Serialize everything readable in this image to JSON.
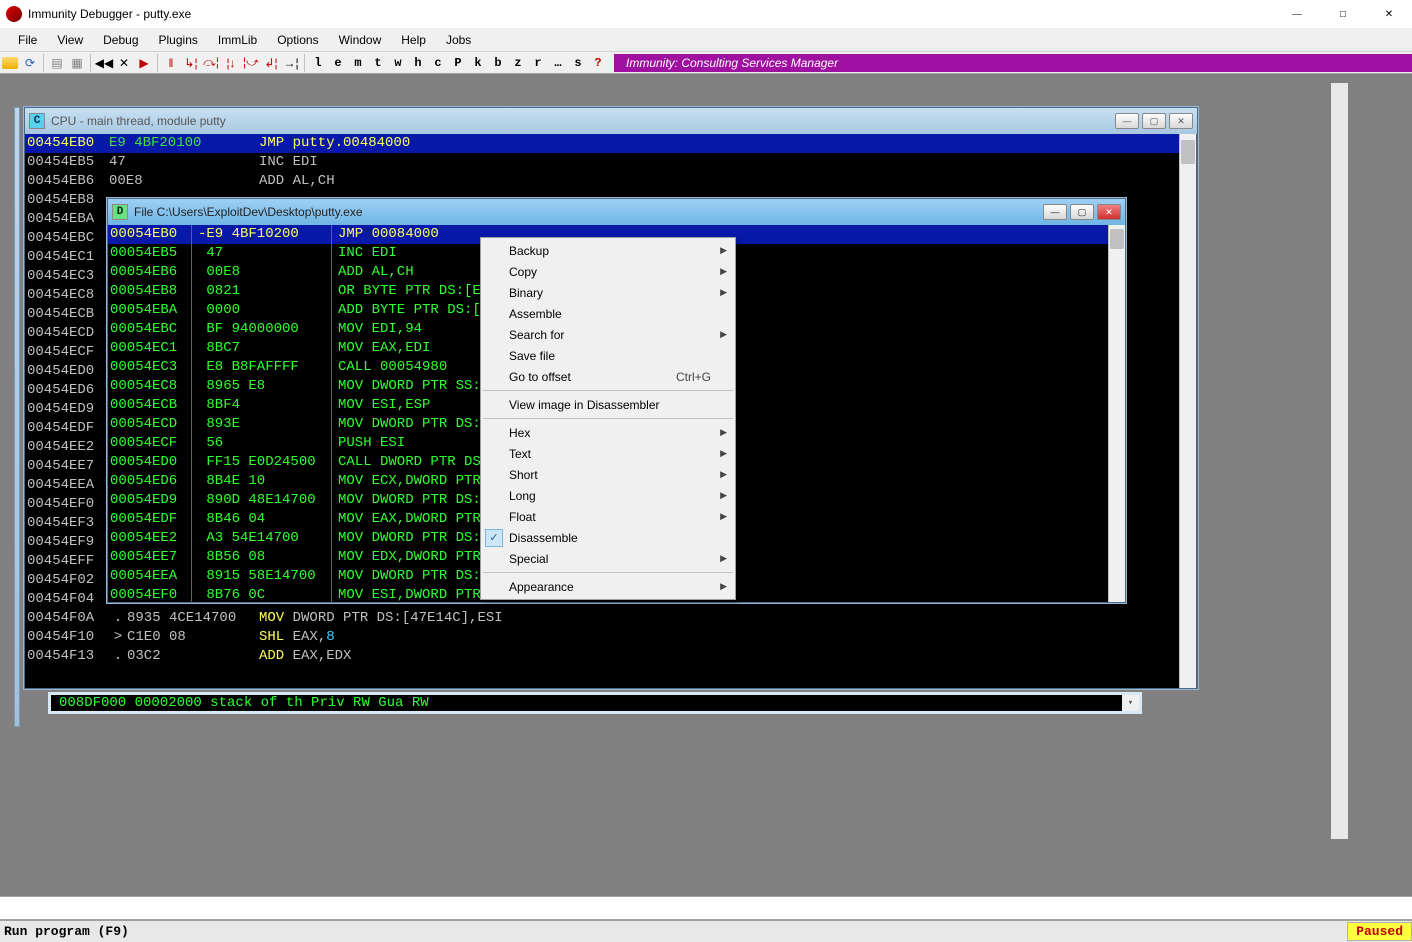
{
  "app": {
    "title": "Immunity Debugger - putty.exe"
  },
  "menu": [
    "File",
    "View",
    "Debug",
    "Plugins",
    "ImmLib",
    "Options",
    "Window",
    "Help",
    "Jobs"
  ],
  "toolbar": {
    "letters": [
      "l",
      "e",
      "m",
      "t",
      "w",
      "h",
      "c",
      "P",
      "k",
      "b",
      "z",
      "r",
      "…",
      "s",
      "?"
    ],
    "banner": "Immunity: Consulting Services Manager"
  },
  "cpu_window": {
    "title": "CPU - main thread, module putty",
    "rows": [
      {
        "addr": "00454EB0",
        "hex": "E9 4BF20100",
        "asm": "JMP putty.00484000",
        "sel": true
      },
      {
        "addr": "00454EB5",
        "hex": "47",
        "asm": "INC EDI"
      },
      {
        "addr": "00454EB6",
        "hex": "00E8",
        "asm": "ADD AL,CH"
      },
      {
        "addr": "00454EB8",
        "hex": "",
        "asm": ""
      },
      {
        "addr": "00454EBA",
        "hex": "",
        "asm": ""
      },
      {
        "addr": "00454EBC",
        "hex": "",
        "asm": ""
      },
      {
        "addr": "00454EC1",
        "hex": "",
        "asm": ""
      },
      {
        "addr": "00454EC3",
        "hex": "",
        "asm": ""
      },
      {
        "addr": "00454EC8",
        "hex": "",
        "asm": ""
      },
      {
        "addr": "00454ECB",
        "hex": "",
        "asm": ""
      },
      {
        "addr": "00454ECD",
        "hex": "",
        "asm": ""
      },
      {
        "addr": "00454ECF",
        "hex": "",
        "asm": ""
      },
      {
        "addr": "00454ED0",
        "hex": "",
        "asm": ""
      },
      {
        "addr": "00454ED6",
        "hex": "",
        "asm": ""
      },
      {
        "addr": "00454ED9",
        "hex": "",
        "asm": ""
      },
      {
        "addr": "00454EDF",
        "hex": "",
        "asm": ""
      },
      {
        "addr": "00454EE2",
        "hex": "",
        "asm": ""
      },
      {
        "addr": "00454EE7",
        "hex": "",
        "asm": ""
      },
      {
        "addr": "00454EEA",
        "hex": "",
        "asm": ""
      },
      {
        "addr": "00454EF0",
        "hex": "",
        "asm": ""
      },
      {
        "addr": "00454EF3",
        "hex": "",
        "asm": ""
      },
      {
        "addr": "00454EF9",
        "hex": "",
        "asm": ""
      },
      {
        "addr": "00454EFF",
        "hex": "",
        "asm": ""
      },
      {
        "addr": "00454F02",
        "hex": "",
        "asm": ""
      },
      {
        "addr": "00454F04",
        "hex": "",
        "asm": ""
      }
    ],
    "tail_rows": [
      {
        "marker": ".",
        "addr": "00454F0A",
        "hex": "8935 4CE14700",
        "mnem": "MOV",
        "ops": "DWORD PTR DS:[47E14C],ESI"
      },
      {
        "marker": ">",
        "addr": "00454F10",
        "hex": "C1E0 08",
        "mnem": "SHL",
        "ops": "EAX,",
        "num": "8"
      },
      {
        "marker": ".",
        "addr": "00454F13",
        "hex": "03C2",
        "mnem": "ADD",
        "ops": "EAX,EDX"
      }
    ]
  },
  "file_window": {
    "title": "File C:\\Users\\ExploitDev\\Desktop\\putty.exe",
    "rows": [
      {
        "addr": "00054EB0",
        "prefix": "-",
        "hex": "E9 4BF10200",
        "asm": "JMP 00084000",
        "sel": true
      },
      {
        "addr": "00054EB5",
        "hex": "47",
        "asm": "INC EDI"
      },
      {
        "addr": "00054EB6",
        "hex": "00E8",
        "asm": "ADD AL,CH"
      },
      {
        "addr": "00054EB8",
        "hex": "0821",
        "asm": "OR BYTE PTR DS:[E"
      },
      {
        "addr": "00054EBA",
        "hex": "0000",
        "asm": "ADD BYTE PTR DS:["
      },
      {
        "addr": "00054EBC",
        "hex": "BF 94000000",
        "asm": "MOV EDI,94"
      },
      {
        "addr": "00054EC1",
        "hex": "8BC7",
        "asm": "MOV EAX,EDI"
      },
      {
        "addr": "00054EC3",
        "hex": "E8 B8FAFFFF",
        "asm": "CALL 00054980"
      },
      {
        "addr": "00054EC8",
        "hex": "8965 E8",
        "asm": "MOV DWORD PTR SS:"
      },
      {
        "addr": "00054ECB",
        "hex": "8BF4",
        "asm": "MOV ESI,ESP"
      },
      {
        "addr": "00054ECD",
        "hex": "893E",
        "asm": "MOV DWORD PTR DS:"
      },
      {
        "addr": "00054ECF",
        "hex": "56",
        "asm": "PUSH ESI"
      },
      {
        "addr": "00054ED0",
        "hex": "FF15 E0D24500",
        "asm": "CALL DWORD PTR DS"
      },
      {
        "addr": "00054ED6",
        "hex": "8B4E 10",
        "asm": "MOV ECX,DWORD PTR"
      },
      {
        "addr": "00054ED9",
        "hex": "890D 48E14700",
        "asm": "MOV DWORD PTR DS:"
      },
      {
        "addr": "00054EDF",
        "hex": "8B46 04",
        "asm": "MOV EAX,DWORD PTR"
      },
      {
        "addr": "00054EE2",
        "hex": "A3 54E14700",
        "asm": "MOV DWORD PTR DS:"
      },
      {
        "addr": "00054EE7",
        "hex": "8B56 08",
        "asm": "MOV EDX,DWORD PTR"
      },
      {
        "addr": "00054EEA",
        "hex": "8915 58E14700",
        "asm": "MOV DWORD PTR DS:"
      },
      {
        "addr": "00054EF0",
        "hex": "8B76 0C",
        "asm": "MOV ESI,DWORD PTR"
      }
    ]
  },
  "context_menu": [
    {
      "label": "Backup",
      "sub": true
    },
    {
      "label": "Copy",
      "sub": true
    },
    {
      "label": "Binary",
      "sub": true
    },
    {
      "label": "Assemble"
    },
    {
      "label": "Search for",
      "sub": true
    },
    {
      "label": "Save file"
    },
    {
      "label": "Go to offset",
      "shortcut": "Ctrl+G"
    },
    {
      "sep": true
    },
    {
      "label": "View image in Disassembler"
    },
    {
      "sep": true
    },
    {
      "label": "Hex",
      "sub": true
    },
    {
      "label": "Text",
      "sub": true
    },
    {
      "label": "Short",
      "sub": true
    },
    {
      "label": "Long",
      "sub": true
    },
    {
      "label": "Float",
      "sub": true
    },
    {
      "label": "Disassemble",
      "checked": true
    },
    {
      "label": "Special",
      "sub": true
    },
    {
      "sep": true
    },
    {
      "label": "Appearance",
      "sub": true
    }
  ],
  "bottom_pane": {
    "text": "008DF000 00002000          stack of th Priv RW  Gua RW"
  },
  "status": {
    "hint": "Run program (F9)",
    "state": "Paused"
  }
}
